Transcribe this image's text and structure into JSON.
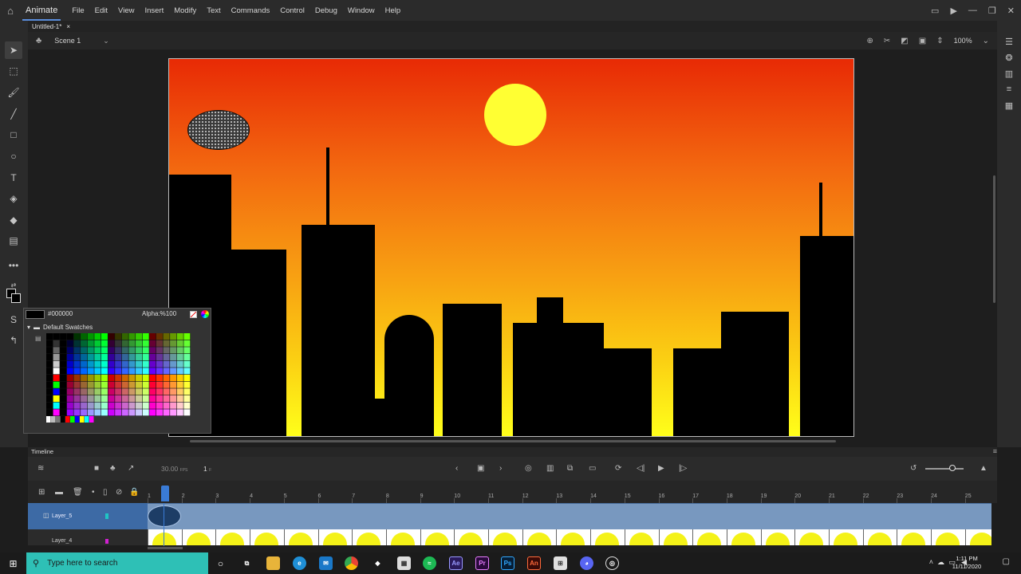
{
  "menubar": {
    "app_name": "Animate",
    "menus": [
      "File",
      "Edit",
      "View",
      "Insert",
      "Modify",
      "Text",
      "Commands",
      "Control",
      "Debug",
      "Window",
      "Help"
    ]
  },
  "document": {
    "tab_title": "Untitled-1*",
    "close_glyph": "×"
  },
  "scene": {
    "label": "Scene 1",
    "zoom": "100%"
  },
  "color": {
    "stroke_fill": "#000000",
    "swatches_hex": "#000000",
    "swatches_alpha": "Alpha:%100",
    "swatch_folder": "Default Swatches",
    "sky_top": "#e82a05",
    "sky_bottom": "#ffff1a",
    "sun": "#ffff33",
    "layer5_color": "#20c4c4",
    "layer4_color": "#d020d0",
    "accent": "#3a7bd5"
  },
  "timeline": {
    "title": "Timeline",
    "fps": "30.00",
    "fps_unit": "FPS",
    "current_frame": "1",
    "frame_unit": "F",
    "ruler": [
      "1",
      "2",
      "3",
      "4",
      "5",
      "6",
      "7",
      "8",
      "9",
      "10",
      "11",
      "12",
      "13",
      "14",
      "15",
      "16",
      "17",
      "18",
      "19",
      "20",
      "21",
      "22",
      "23",
      "24",
      "25"
    ],
    "layers": [
      {
        "name": "Layer_5"
      },
      {
        "name": "Layer_4"
      }
    ]
  },
  "taskbar": {
    "search_placeholder": "Type here to search",
    "time": "1:11 PM",
    "date": "11/11/2020",
    "apps": [
      "Ae",
      "Pr",
      "Ps",
      "An"
    ]
  },
  "icons": {
    "home": "home-icon",
    "play": "play-icon",
    "selection": "selection-tool-icon",
    "brush": "brush-icon",
    "text": "text-tool-icon",
    "timeline_play": "timeline-play-icon"
  }
}
